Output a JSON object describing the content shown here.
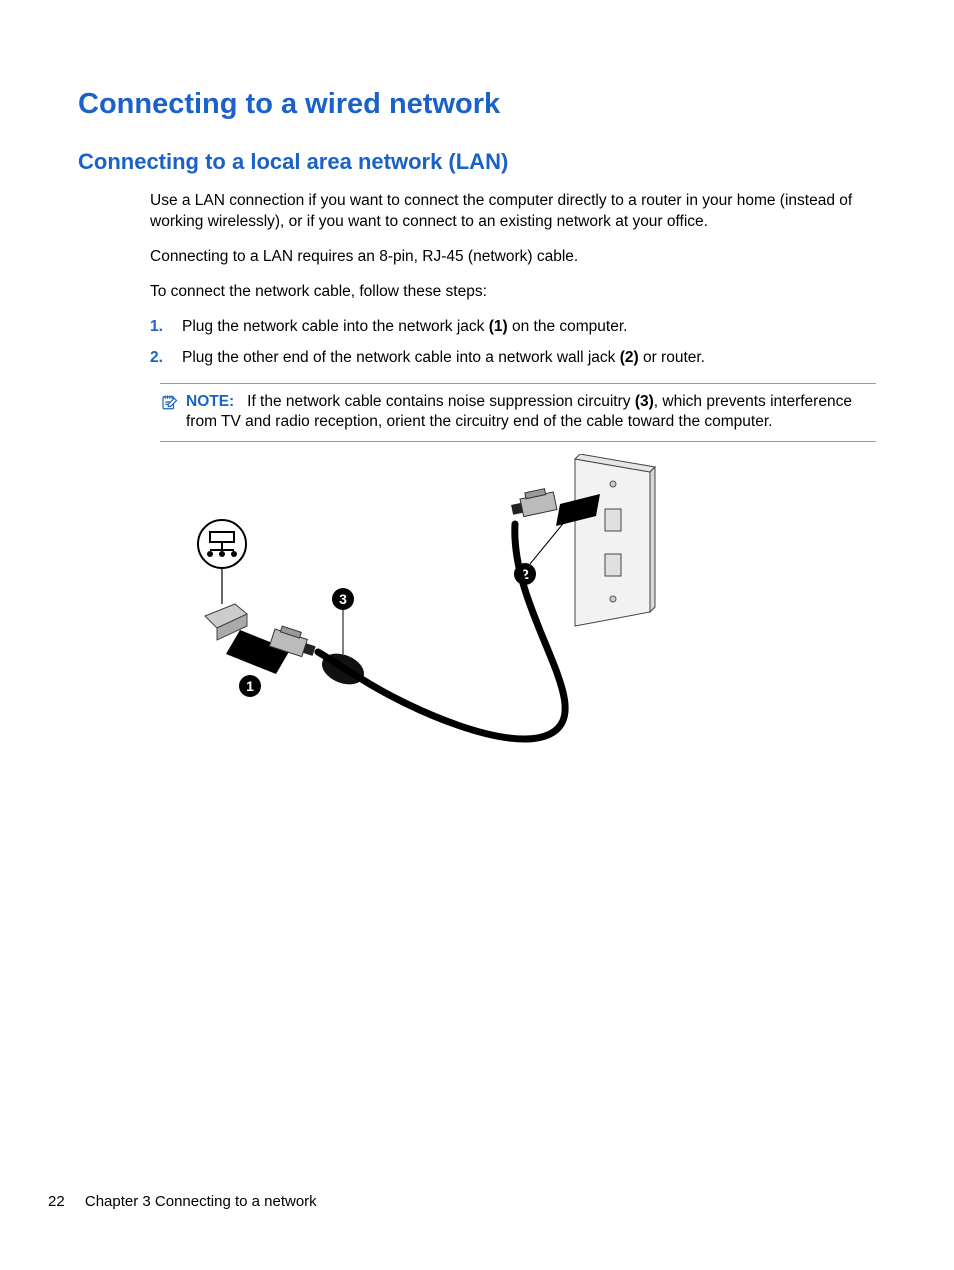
{
  "heading1": "Connecting to a wired network",
  "heading2": "Connecting to a local area network (LAN)",
  "para1": "Use a LAN connection if you want to connect the computer directly to a router in your home (instead of working wirelessly), or if you want to connect to an existing network at your office.",
  "para2": "Connecting to a LAN requires an 8-pin, RJ-45 (network) cable.",
  "para3": "To connect the network cable, follow these steps:",
  "steps": [
    {
      "num": "1.",
      "pre": "Plug the network cable into the network jack ",
      "bold": "(1)",
      "post": " on the computer."
    },
    {
      "num": "2.",
      "pre": "Plug the other end of the network cable into a network wall jack ",
      "bold": "(2)",
      "post": " or router."
    }
  ],
  "note": {
    "label": "NOTE:",
    "pre": "If the network cable contains noise suppression circuitry ",
    "bold": "(3)",
    "post": ", which prevents interference from TV and radio reception, orient the circuitry end of the cable toward the computer."
  },
  "callouts": {
    "c1": "1",
    "c2": "2",
    "c3": "3"
  },
  "footer": {
    "page": "22",
    "chapter": "Chapter 3   Connecting to a network"
  }
}
